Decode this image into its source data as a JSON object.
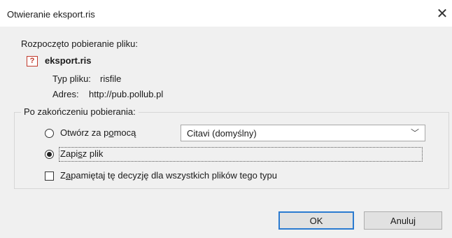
{
  "dialog": {
    "title": "Otwieranie eksport.ris",
    "close_glyph": "✕"
  },
  "download": {
    "started_text": "Rozpoczęto pobieranie pliku:",
    "file_icon_glyph": "?",
    "file_name": "eksport.ris",
    "type_label": "Typ pliku:",
    "type_value": "risfile",
    "address_label": "Adres:",
    "address_value": "http://pub.pollub.pl"
  },
  "after_download": {
    "group_title": "Po zakończeniu pobierania:",
    "open_with": {
      "label_pre": "Otwórz za p",
      "label_accel": "o",
      "label_post": "mocą",
      "checked": false
    },
    "app_select": {
      "value": "Citavi (domyślny)",
      "chevron": "﹀"
    },
    "save_file": {
      "label_pre": "Zapi",
      "label_accel": "s",
      "label_post": "z plik",
      "checked": true
    },
    "remember": {
      "label_pre": "Z",
      "label_accel": "a",
      "label_post": "pamiętaj tę decyzję dla wszystkich plików tego typu",
      "checked": false
    }
  },
  "buttons": {
    "ok_label": "OK",
    "cancel_label": "Anuluj"
  },
  "colors": {
    "focus_border": "#2b7bd0",
    "file_icon": "#c0392b",
    "background": "#f0f0f0"
  },
  "icons": {
    "file": "file-type-icon",
    "close": "close-icon",
    "dropdown": "chevron-down-icon"
  }
}
